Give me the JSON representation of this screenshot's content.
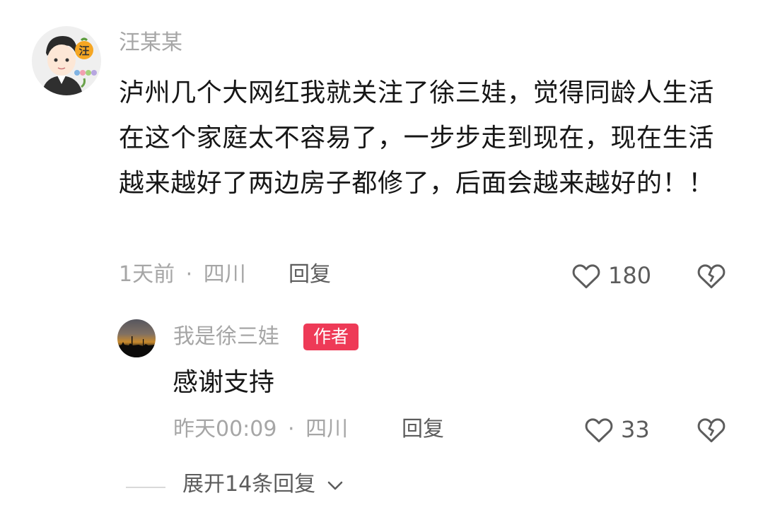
{
  "comment": {
    "username": "汪某某",
    "text": "泸州几个大网红我就关注了徐三娃，觉得同龄人生活在这个家庭太不容易了，一步步走到现在，现在生活越来越好了两边房子都修了，后面会越来越好的！！",
    "time": "1天前",
    "location": "四川",
    "separator": "·",
    "reply_label": "回复",
    "likes": "180",
    "avatar_badge": "汪"
  },
  "reply": {
    "username": "我是徐三娃",
    "author_badge": "作者",
    "text": "感谢支持",
    "time": "昨天00:09",
    "location": "四川",
    "separator": "·",
    "reply_label": "回复",
    "likes": "33"
  },
  "expand": {
    "label": "展开14条回复"
  },
  "colors": {
    "author_badge": "#ee3a57",
    "meta_text": "#a6a6a6",
    "body_text": "#161616"
  },
  "icons": [
    "heart-icon",
    "dislike-broken-heart-icon",
    "chevron-down-icon"
  ]
}
